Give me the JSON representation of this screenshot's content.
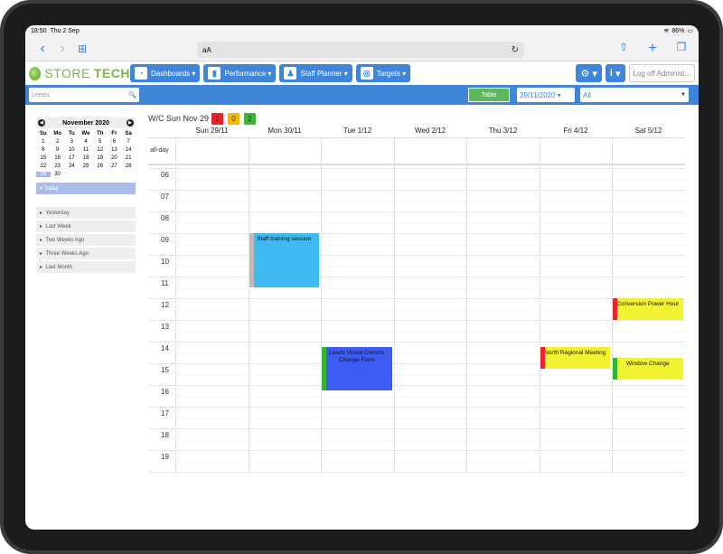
{
  "status": {
    "time": "18:50",
    "date": "Thu 2 Sep",
    "battery": "86%"
  },
  "safari": {
    "url_text": "aA"
  },
  "app": {
    "logo_a": "STORE",
    "logo_b": "TECH",
    "menus": [
      "Dashboards",
      "Performance",
      "Staff Planner",
      "Targets"
    ],
    "logoff": "Log off Administ..."
  },
  "filters": {
    "search_placeholder": "Leeds",
    "table_label": "Table",
    "date_value": "29/11/2020",
    "all_value": "All"
  },
  "mini_calendar": {
    "title": "November 2020",
    "weekday_headers": [
      "Su",
      "Mo",
      "Tu",
      "We",
      "Th",
      "Fr",
      "Sa"
    ],
    "days": [
      "1",
      "2",
      "3",
      "4",
      "5",
      "6",
      "7",
      "8",
      "9",
      "10",
      "11",
      "12",
      "13",
      "14",
      "15",
      "16",
      "17",
      "18",
      "19",
      "20",
      "21",
      "22",
      "23",
      "24",
      "25",
      "26",
      "27",
      "28",
      "29",
      "30"
    ],
    "selected": "29",
    "today_label": "Today",
    "ranges": [
      "Yesterday",
      "Last Week",
      "Two Weeks Ago",
      "Three Weeks Ago",
      "Last Month"
    ]
  },
  "calendar": {
    "week_label": "W/C Sun Nov 29",
    "badges": [
      {
        "value": "2",
        "color": "#e8232a"
      },
      {
        "value": "0",
        "color": "#f2b705"
      },
      {
        "value": "2",
        "color": "#3cb53c"
      }
    ],
    "day_headers": [
      "Sun 29/11",
      "Mon 30/11",
      "Tue 1/12",
      "Wed 2/12",
      "Thu 3/12",
      "Fri 4/12",
      "Sat 5/12"
    ],
    "allday_label": "all-day",
    "hours": [
      "06",
      "07",
      "08",
      "09",
      "10",
      "11",
      "12",
      "13",
      "14",
      "15",
      "16",
      "17",
      "18",
      "19",
      "20"
    ],
    "events": [
      {
        "title": "Staff training session",
        "day": 1,
        "start": 9,
        "end": 11.5,
        "color": "#40baf0",
        "bar": "#bbbbbb"
      },
      {
        "title": "Leeds Visual Comms Change Form",
        "day": 2,
        "start": 14.25,
        "end": 16.25,
        "color": "#3f5cf2",
        "bar": "#33b533"
      },
      {
        "title": "North Regional Meeting",
        "day": 5,
        "start": 14.25,
        "end": 15.25,
        "color": "#f2f232",
        "bar": "#e8232a"
      },
      {
        "title": "Conversion Power Hour",
        "day": 6,
        "start": 12,
        "end": 13,
        "color": "#f2f232",
        "bar": "#e8232a"
      },
      {
        "title": "Window Change",
        "day": 6,
        "start": 14.75,
        "end": 15.75,
        "color": "#f2f232",
        "bar": "#33b533"
      }
    ]
  }
}
